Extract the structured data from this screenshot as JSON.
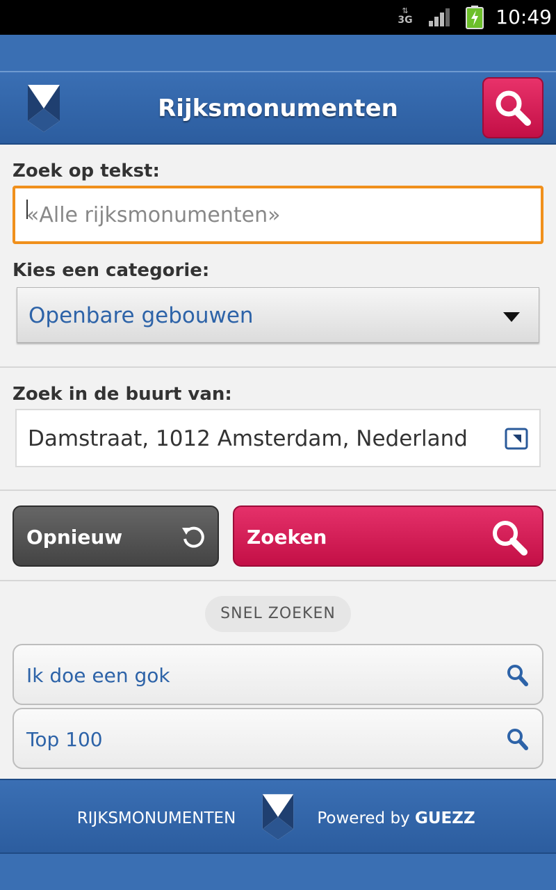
{
  "status_bar": {
    "network": "3G",
    "time": "10:49",
    "icons": [
      "data-arrows-icon",
      "signal-icon",
      "battery-charging-icon"
    ]
  },
  "header": {
    "title": "Rijksmonumenten",
    "logo_icon": "shield-logo-icon",
    "search_icon": "search-icon"
  },
  "form": {
    "text_label": "Zoek op tekst:",
    "text_placeholder": "«Alle rijksmonumenten»",
    "text_value": "",
    "category_label": "Kies een categorie:",
    "category_selected": "Openbare gebouwen",
    "near_label": "Zoek in de buurt van:",
    "near_value": "Damstraat, 1012 Amsterdam, Nederland"
  },
  "buttons": {
    "reset_label": "Opnieuw",
    "search_label": "Zoeken"
  },
  "quick_search": {
    "title": "SNEL ZOEKEN",
    "items": [
      {
        "label": "Ik doe een gok"
      },
      {
        "label": "Top 100"
      }
    ]
  },
  "footer": {
    "brand": "RIJKSMONUMENTEN",
    "powered_prefix": "Powered by",
    "powered_name": "GUEZZ"
  },
  "colors": {
    "primary_blue": "#2f63a6",
    "accent_red": "#d41e55",
    "focus_orange": "#f0901c",
    "link_blue": "#2d63a8"
  }
}
